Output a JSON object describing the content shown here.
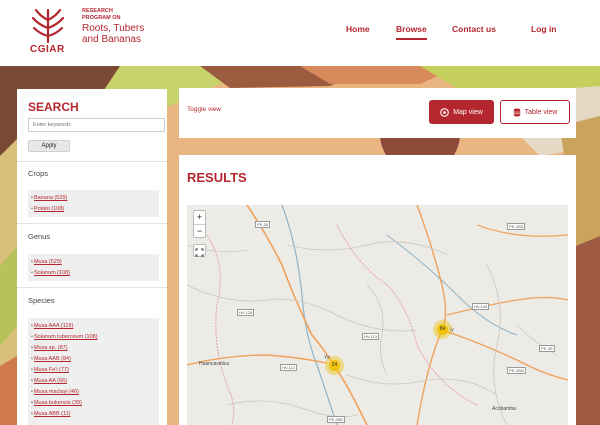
{
  "header": {
    "logo_wordmark": "CGIAR",
    "program_small_line1": "RESEARCH",
    "program_small_line2": "PROGRAM ON",
    "program_name_line1": "Roots, Tubers",
    "program_name_line2": "and Bananas",
    "nav": [
      {
        "label": "Home"
      },
      {
        "label": "Browse",
        "active": true
      },
      {
        "label": "Contact us"
      },
      {
        "label": "Log in"
      }
    ]
  },
  "search": {
    "title": "SEARCH",
    "placeholder": "Enter keywords",
    "apply_label": "Apply"
  },
  "facets": {
    "crops": {
      "title": "Crops",
      "items": [
        "Banana (529)",
        "Potato (108)"
      ]
    },
    "genus": {
      "title": "Genus",
      "items": [
        "Musa (529)",
        "Solanum (108)"
      ]
    },
    "species": {
      "title": "Species",
      "items": [
        "Musa AAA (119)",
        "Solanum tuberosum (108)",
        "Musa sp. (87)",
        "Musa AAB (84)",
        "Musa Fe'i (77)",
        "Musa AA (66)",
        "Musa maclayi (46)",
        "Musa bukensis (39)",
        "Musa ABB (11)"
      ]
    }
  },
  "toggle": {
    "label": "Toggle view",
    "map_view_label": "Map view",
    "table_view_label": "Table view"
  },
  "results": {
    "title": "RESULTS",
    "zoom_in": "+",
    "zoom_out": "−",
    "clusters": [
      {
        "count": "24"
      },
      {
        "count": "84"
      }
    ],
    "places": {
      "huancavelica": "Huancavelica",
      "acobamba": "Acobamba",
      "ya": "Ya",
      "ly": "ly"
    },
    "road_labels": {
      "pe26": "PE-26",
      "pe3sd": "PE-3SD",
      "hv128": "HV-128",
      "hv106": "HV-106",
      "hv113": "HV-113",
      "hv112": "HV-112",
      "pe3s": "PE-3S",
      "pe3sm": "PE-3SM",
      "pe26b": "PE-26B"
    }
  },
  "colors": {
    "brand_red": "#b5272e",
    "cluster_yellow": "#f0c20c"
  }
}
